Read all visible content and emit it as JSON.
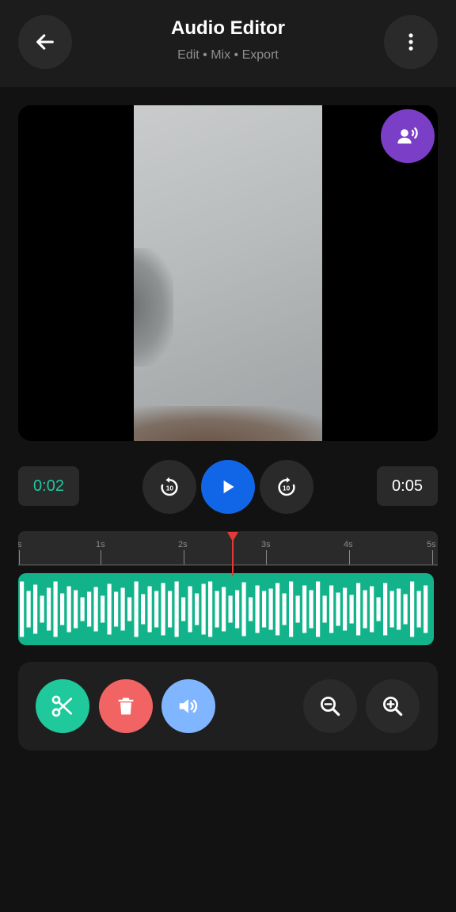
{
  "header": {
    "title": "Audio Editor",
    "subtitle": "Edit • Mix • Export",
    "back_icon": "arrow-left-icon",
    "menu_icon": "more-vertical-icon"
  },
  "video": {
    "voice_icon": "voice-over-icon",
    "voice_button_color": "#7b3fc7"
  },
  "transport": {
    "current_time": "0:02",
    "total_time": "0:05",
    "rewind_icon": "replay-10-icon",
    "play_icon": "play-icon",
    "forward_icon": "forward-10-icon",
    "play_color": "#1166e8"
  },
  "timeline": {
    "tick_labels": [
      "s",
      "1s",
      "2s",
      "3s",
      "4s",
      "5s"
    ],
    "playhead_seconds": 2.6,
    "waveform_color": "#12b38b",
    "accent_color": "#1fc8a0"
  },
  "tools": {
    "cut_icon": "scissors-icon",
    "delete_icon": "trash-icon",
    "volume_icon": "volume-icon",
    "zoom_out_icon": "zoom-out-icon",
    "zoom_in_icon": "zoom-in-icon",
    "cut_color": "#1fc99c",
    "delete_color": "#f26464",
    "volume_color": "#7fb6ff"
  }
}
